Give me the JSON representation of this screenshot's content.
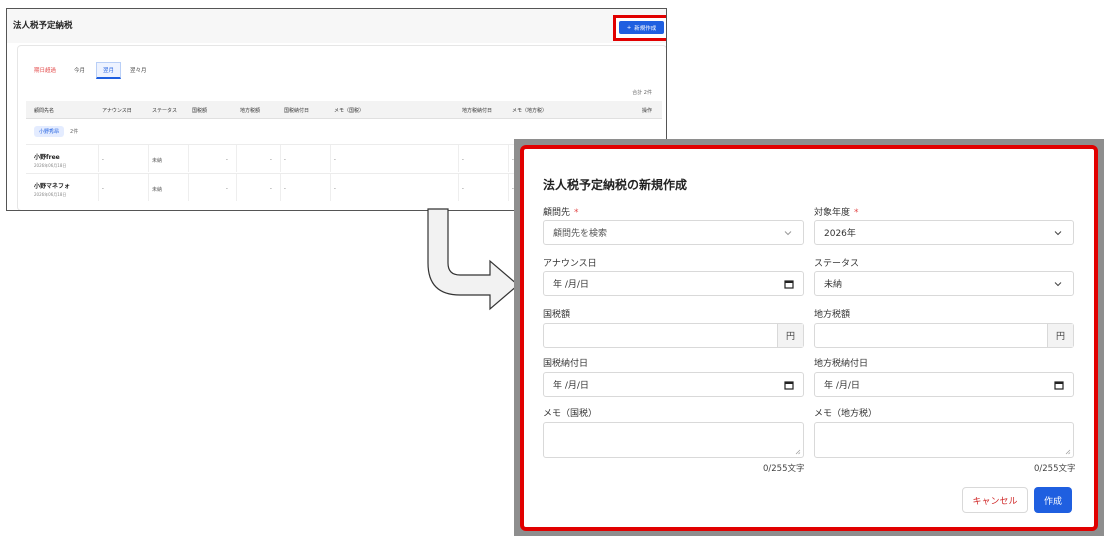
{
  "background": {
    "title": "法人税予定納税",
    "new_button_label": "新規作成",
    "tabs": [
      {
        "label": "期日超過",
        "style": "red"
      },
      {
        "label": "今月",
        "style": "normal"
      },
      {
        "label": "翌月",
        "style": "active"
      },
      {
        "label": "翌々月",
        "style": "normal"
      }
    ],
    "total": "合計 2件",
    "columns": [
      "顧問先名",
      "アナウンス日",
      "ステータス",
      "国税額",
      "地方税額",
      "国税納付日",
      "メモ（国税）",
      "地方税納付日",
      "メモ（地方税）",
      "操作"
    ],
    "group": {
      "name": "小野秀昂",
      "count": "2件"
    },
    "rows": [
      {
        "name": "小野free",
        "date": "2026年06月18日",
        "announce": "-",
        "status": "未納",
        "national": "-",
        "local": "-",
        "national_pay": "-",
        "memo_national": "-",
        "local_pay": "-",
        "memo_local": "-"
      },
      {
        "name": "小野マネフォ",
        "date": "2026年06月18日",
        "announce": "-",
        "status": "未納",
        "national": "-",
        "local": "-",
        "national_pay": "-",
        "memo_national": "-",
        "local_pay": "-",
        "memo_local": "-"
      }
    ]
  },
  "modal": {
    "title": "法人税予定納税の新規作成",
    "client": {
      "label": "顧問先",
      "required_mark": "*",
      "placeholder": "顧問先を検索"
    },
    "fiscal_year": {
      "label": "対象年度",
      "required_mark": "*",
      "value": "2026年"
    },
    "announce_date": {
      "label": "アナウンス日",
      "value": "年 /月/日"
    },
    "status": {
      "label": "ステータス",
      "value": "未納"
    },
    "national_tax": {
      "label": "国税額",
      "unit": "円"
    },
    "local_tax": {
      "label": "地方税額",
      "unit": "円"
    },
    "national_pay_date": {
      "label": "国税納付日",
      "value": "年 /月/日"
    },
    "local_pay_date": {
      "label": "地方税納付日",
      "value": "年 /月/日"
    },
    "memo_national": {
      "label": "メモ（国税）",
      "counter": "0/255文字"
    },
    "memo_local": {
      "label": "メモ（地方税）",
      "counter": "0/255文字"
    },
    "cancel_label": "キャンセル",
    "create_label": "作成"
  }
}
